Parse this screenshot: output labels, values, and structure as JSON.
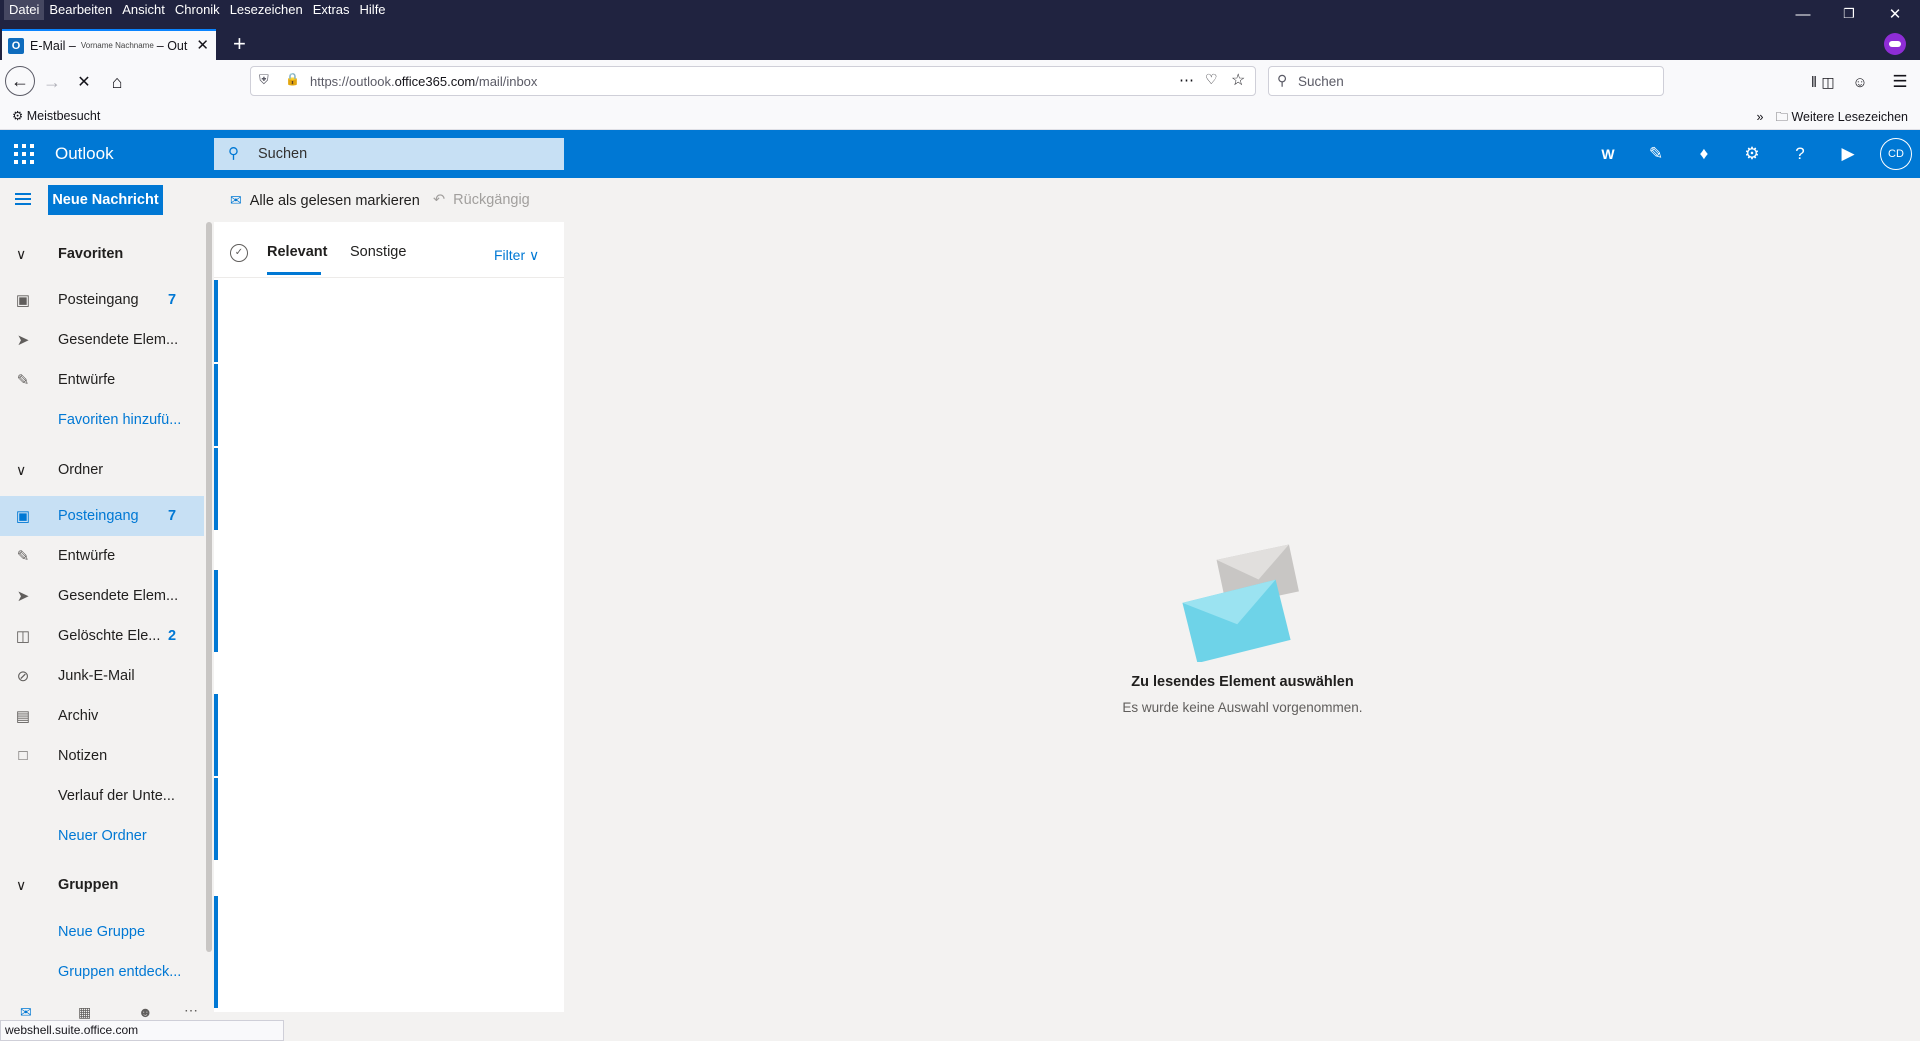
{
  "browser": {
    "menu": [
      "Datei",
      "Bearbeiten",
      "Ansicht",
      "Chronik",
      "Lesezeichen",
      "Extras",
      "Hilfe"
    ],
    "tab": {
      "title_prefix": "E-Mail –",
      "title_user": "Vorname Nachname",
      "title_suffix": "– Out"
    },
    "url_prefix": "https://outlook.",
    "url_domain": "office365.com",
    "url_path": "/mail/inbox",
    "search_placeholder": "Suchen",
    "bookmark_most_visited": "Meistbesucht",
    "bookmark_more": "Weitere Lesezeichen",
    "status_url": "webshell.suite.office.com"
  },
  "outlook": {
    "brand": "Outlook",
    "search_placeholder": "Suchen",
    "avatar_initials": "CD",
    "new_message": "Neue Nachricht",
    "mark_all_read": "Alle als gelesen markieren",
    "undo": "Rückgängig",
    "header_icons": [
      "word-icon",
      "todo-icon",
      "bell-icon",
      "settings-icon",
      "help-icon",
      "feedback-icon"
    ]
  },
  "nav": {
    "favorites_label": "Favoriten",
    "favorites": [
      {
        "label": "Posteingang",
        "count": "7",
        "icon": "inbox-icon"
      },
      {
        "label": "Gesendete Elem...",
        "count": "",
        "icon": "send-icon"
      },
      {
        "label": "Entwürfe",
        "count": "",
        "icon": "pencil-icon"
      }
    ],
    "add_favorite": "Favoriten hinzufü...",
    "folders_label": "Ordner",
    "folders": [
      {
        "label": "Posteingang",
        "count": "7",
        "icon": "inbox-icon"
      },
      {
        "label": "Entwürfe",
        "count": "",
        "icon": "pencil-icon"
      },
      {
        "label": "Gesendete Elem...",
        "count": "",
        "icon": "send-icon"
      },
      {
        "label": "Gelöschte Ele...",
        "count": "2",
        "icon": "trash-icon"
      },
      {
        "label": "Junk-E-Mail",
        "count": "",
        "icon": "block-icon"
      },
      {
        "label": "Archiv",
        "count": "",
        "icon": "archive-icon"
      },
      {
        "label": "Notizen",
        "count": "",
        "icon": "note-icon"
      },
      {
        "label": "Verlauf der Unte...",
        "count": "",
        "icon": ""
      }
    ],
    "new_folder": "Neuer Ordner",
    "groups_label": "Gruppen",
    "new_group": "Neue Gruppe",
    "discover_groups": "Gruppen entdeck..."
  },
  "list": {
    "tab_focused": "Relevant",
    "tab_other": "Sonstige",
    "filter": "Filter"
  },
  "reading": {
    "empty_title": "Zu lesendes Element auswählen",
    "empty_subtitle": "Es wurde keine Auswahl vorgenommen."
  },
  "colors": {
    "accent": "#0078d4",
    "browser_dark": "#202340",
    "selected": "#c7e0f4"
  }
}
